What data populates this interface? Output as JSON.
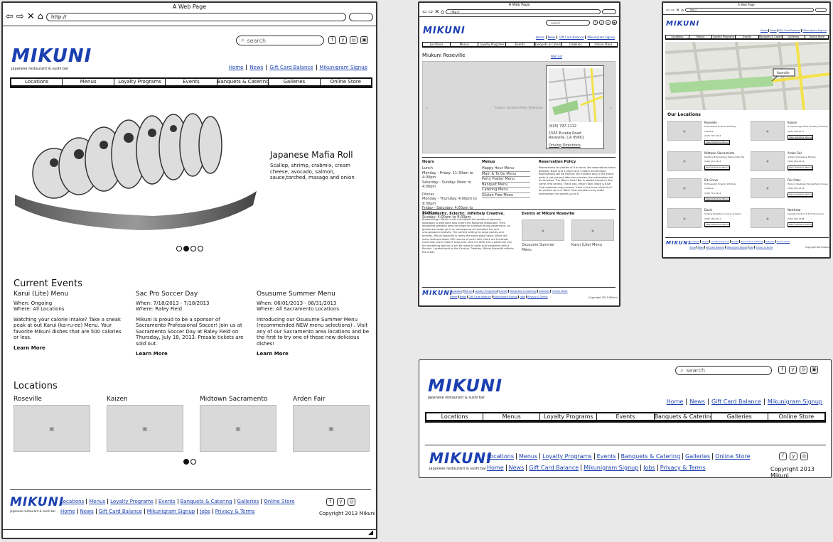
{
  "browser": {
    "title": "A Web Page",
    "url": "http://"
  },
  "brand": {
    "logo": "MIKUNI",
    "tagline": "japanese restaurant & sushi bar"
  },
  "search": {
    "placeholder": "search"
  },
  "top_links": [
    "Home",
    "News",
    "Gift Card Balance",
    "Mikunigram Signup"
  ],
  "nav": [
    "Locations",
    "Menus",
    "Loyalty Programs",
    "Events",
    "Banquets & Catering",
    "Galleries",
    "Online Store"
  ],
  "hero": {
    "title": "Japanese Mafia Roll",
    "description": "Scallop, shrimp, crabmix, cream cheese, avocado, salmon, sauce,torched, masago and onion",
    "slide_count": 4,
    "active_slide": 2
  },
  "events": {
    "heading": "Current Events",
    "items": [
      {
        "title": "Karui (Lite) Menu",
        "when": "When: Ongoing",
        "where": "Where: All Locations",
        "body": "Watching your calorie intake? Take a sneak peak at out Karui (ka-ru-ee) Menu. Your favorite Mikuni dishes that are 500 calories or less.",
        "link": "Learn More"
      },
      {
        "title": "Sac Pro Soccer Day",
        "when": "When: 7/18/2013 - 7/18/2013",
        "where": "Where: Raley Field",
        "body": "Mikuni is proud to be a sponsor of Sacramento Professional Soccer! Join us at Sacramento Soccer Day at Raley Field on Thursday, July 18, 2013. Presale tickets are sold out.",
        "link": "Learn More"
      },
      {
        "title": "Osusume Summer Menu",
        "when": "When: 06/01/2013 - 08/31/2013",
        "where": "Where: All Sacramento Locations",
        "body": "Introducing our Osusume Summer Menu (recommended NEW menu selections) . Visit any of our Sacramento area locations and be the first to try one of these new delicious dishes!",
        "link": "Learn More"
      }
    ]
  },
  "locations": {
    "heading": "Locations",
    "items": [
      "Roseville",
      "Kaizen",
      "Midtown Sacramento",
      "Arden Fair"
    ]
  },
  "footer": {
    "row1": [
      "Locations",
      "Menus",
      "Loyalty Programs",
      "Events",
      "Banquets & Catering",
      "Galleries",
      "Online Store"
    ],
    "row2": [
      "Home",
      "News",
      "Gift Card Balance",
      "Mikunigram Signup",
      "Jobs",
      "Privacy & Terms"
    ],
    "copyright": "Copyright 2013 Mikuni"
  },
  "roseville": {
    "title": "Miukuni Roseville",
    "wait_link": "Wait list",
    "slideshow_label": "Food or Location Photo Slideshow",
    "phone": "(916) 797-2112",
    "address1": "1565 Eureka Road",
    "address2": "Roseville, CA 95661",
    "directions": "Driving Directions",
    "hours_h": "Hours",
    "hours_lines": [
      "Lunch",
      "Monday - Friday: 11:30am to 4:00pm",
      "Saturday - Sunday: Noon to 4:00pm",
      "",
      "Dinner",
      "Monday - Thursday: 4:00pm to 9:30pm",
      "Friday - Saturday: 4:00pm to 10:30pm",
      "Sunday: 4:00pm to 9:00pm"
    ],
    "menus_h": "Menus",
    "menus": [
      "Happy Hour Menu",
      "Main & To Go Menu",
      "Party Platter Menu",
      "Banquet Menu",
      "Catering Menu",
      "Gluten Free Menu"
    ],
    "reservation_h": "Reservation Policy",
    "reservation_text": "Reservations for parties of 8 or more. No reservations taken between Noon and 1:00pm and 7:00pm and 8:00pm. Reservations will be held for ten minutes only. If the entire party is not present after ten minutes, the reservation will be forfeited. The Mikuni Sushi Bar is seated based on first come, first served. Thank you. Mikuni Koki, Black & Blue Club members may reserve \"Lane in the front of the line\" for parties up to 4. Black Club members may make reservations for parties up to 8.",
    "about_h": "Enthusiastic. Eclectic. Infinitely Creative.",
    "about_text": "Breakthrough Mikuni chefs cultivated the traditional Japanese education to everyone who enters the Roseville restaurant. Their exuberant greeting sets the stage for a festive dining experience, as guests are swept up in an atmosphere of controlled fun and unsurpassed creativity. The perfect setting for large parties and families, Mikuni Roseville is rarely the same place twice. While the menu features about 160 choices of sushi rolls, there are hundreds more that never make it onto print. And if a diner has a particular yen for something special, it will be made to order and presented with a flourish. Located next to the Century Theatres, Mikuni Roseville reflects the urban",
    "events_h": "Events at Mikuni Roseville",
    "event_items": [
      "Osusume Summer Menu",
      "Karui (Lite) Menu"
    ]
  },
  "locations_page": {
    "heading": "Our Locations",
    "map_label": "Roseville",
    "items": [
      {
        "name": "Roseville",
        "desc": "Enthusiastic Eclectic Infinitely Creative",
        "phone": "(916) 797-2112"
      },
      {
        "name": "Kaizen",
        "desc": "Unique Imaginative Visually Arresting",
        "phone": "(916) 786-0777"
      },
      {
        "name": "Midtown Sacramento",
        "desc": "Dazzling Exhilarating Fashionably Hip",
        "phone": "(916) 447-2112"
      },
      {
        "name": "Arden Fair",
        "desc": "Artistic Impressive Modern",
        "phone": "(916) 564-2114"
      },
      {
        "name": "Elk Grove",
        "desc": "Enthusiastic Eclectic Infinitely Creative",
        "phone": "(916) 714-2112"
      },
      {
        "name": "Fair Oaks",
        "desc": "Historic Nostalgic Wonderfully Unique",
        "phone": "(916) 961-2112"
      },
      {
        "name": "Davis",
        "desc": "Smiling Neighborly Young at Heart",
        "phone": "(530) 756-2111"
      },
      {
        "name": "Northstar",
        "desc": "Sensational Surf & Turf Adventure",
        "phone": "(530) 562-2188"
      }
    ],
    "detail_button": "View Details & Menus"
  },
  "colors": {
    "accent": "#1a3fb0",
    "frame": "#333333",
    "background": "#e9e9e9"
  }
}
